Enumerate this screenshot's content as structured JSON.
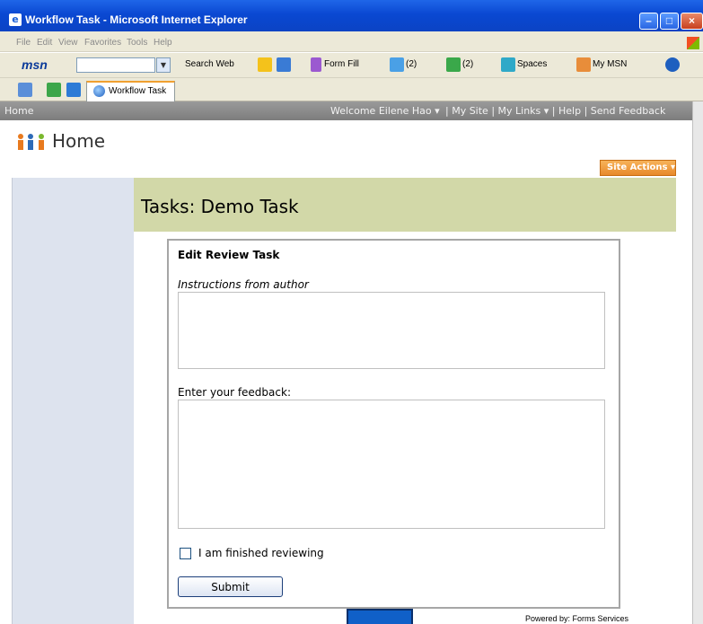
{
  "window": {
    "title": "Workflow Task - Microsoft Internet Explorer",
    "controls": {
      "minimize": "–",
      "maximize": "□",
      "close": "×"
    }
  },
  "menu": [
    "File",
    "Edit",
    "View",
    "Favorites",
    "Tools",
    "Help"
  ],
  "msn_toolbar": {
    "logo": "msn",
    "search_value": "",
    "search_web": "Search Web",
    "form_fill": "Form Fill",
    "mail_count": "(2)",
    "messenger_count": "(2)",
    "spaces": "Spaces",
    "my_msn": "My MSN"
  },
  "tab": {
    "label": "Workflow Task"
  },
  "sp_nav": {
    "home": "Home",
    "welcome": "Welcome Eilene Hao ▾",
    "links": "| My Site  | My Links ▾ | Help  |  Send Feedback"
  },
  "header": {
    "site_title": "Home",
    "site_actions": "Site Actions ▾"
  },
  "page": {
    "title": "Tasks: Demo Task"
  },
  "form": {
    "heading": "Edit Review Task",
    "instructions_label": "Instructions from author",
    "feedback_label": "Enter your feedback:",
    "feedback_value": "",
    "finished_label": "I am finished reviewing",
    "finished_checked": false,
    "submit_label": "Submit"
  },
  "footer": {
    "powered_by": "Powered by: Forms Services"
  },
  "colors": {
    "title_bar": "#0a48d2",
    "task_banner": "#d2d8a8",
    "left_panel": "#dde3ee",
    "site_actions": "#e8892a",
    "top_nav": "#8a8a8a"
  },
  "icons": [
    "ie-page-icon",
    "windows-flag-icon",
    "pencil-icon",
    "form-fill-icon",
    "mail-icon",
    "messenger-icon",
    "spaces-icon",
    "my-msn-icon",
    "help-icon",
    "home-icon",
    "people-icon"
  ]
}
